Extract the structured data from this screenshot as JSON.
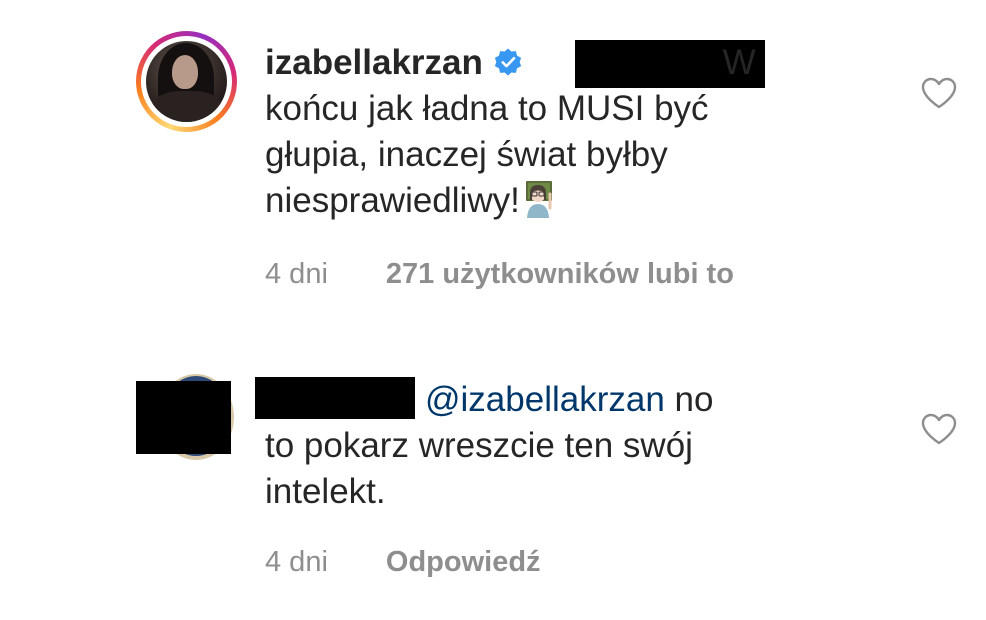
{
  "comments": [
    {
      "username": "izabellakrzan",
      "verified": true,
      "text_line1_tail": "W",
      "text_line2": "końcu jak ładna to MUSI być",
      "text_line3": "głupia, inaczej świat byłby",
      "text_line4": "niesprawiedliwy!",
      "emoji_name": "woman-teacher-emoji",
      "time": "4 dni",
      "likes": "271 użytkowników lubi to",
      "icon": "heart-outline-icon"
    },
    {
      "mention": "@izabellakrzan",
      "text_line1_tail": "no",
      "text_line2": "to pokarz wreszcie ten swój",
      "text_line3": "intelekt.",
      "time": "4 dni",
      "reply_label": "Odpowiedź",
      "icon": "heart-outline-icon"
    }
  ],
  "colors": {
    "text": "#262626",
    "meta": "#8e8e8e",
    "mention": "#00376b",
    "verified": "#3897f0",
    "redaction": "#000000"
  }
}
